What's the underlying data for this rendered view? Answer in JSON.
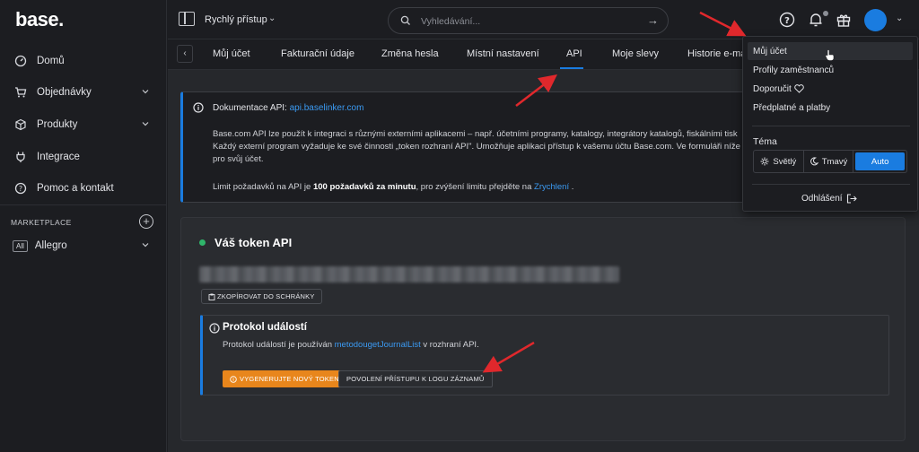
{
  "logo": "base.",
  "sidebar": {
    "items": [
      {
        "label": "Domů",
        "icon": "dashboard-icon"
      },
      {
        "label": "Objednávky",
        "icon": "cart-icon"
      },
      {
        "label": "Produkty",
        "icon": "box-icon"
      },
      {
        "label": "Integrace",
        "icon": "plug-icon"
      },
      {
        "label": "Pomoc a kontakt",
        "icon": "help-icon"
      }
    ],
    "marketplace_heading": "MARKETPLACE",
    "marketplace_tag": "All",
    "marketplace_item": "Allegro"
  },
  "topbar": {
    "quick_access": "Rychlý přístup",
    "search_placeholder": "Vyhledávání..."
  },
  "tabs": [
    "Můj účet",
    "Fakturační údaje",
    "Změna hesla",
    "Místní nastavení",
    "API",
    "Moje slevy",
    "Historie e-ma"
  ],
  "api_info": {
    "doc_label": "Dokumentace API:",
    "doc_link": "api.baselinker.com",
    "desc_line1": "Base.com API lze použít k integraci s různými externími aplikacemi – např. účetními programy, katalogy, integrátory katalogů, fiskálními tisk",
    "desc_line2": "Každý externí program vyžaduje ke své činnosti „token rozhraní API\". Umožňuje aplikaci přístup k vašemu účtu Base.com. Ve formuláři níže",
    "desc_line3": "pro svůj účet.",
    "limit_prefix": "Limit požadavků na API je",
    "limit_value": "100 požadavků za minutu",
    "limit_mid": ", pro zvýšení limitu přejděte na",
    "limit_link": "Zrychlení",
    "limit_suffix": "."
  },
  "token": {
    "title": "Váš token API",
    "copy_button": "ZKOPÍROVAT DO SCHRÁNKY"
  },
  "events": {
    "title": "Protokol událostí",
    "desc_prefix": "Protokol událostí je používán",
    "desc_link": "metodougetJournalList",
    "desc_suffix": "v rozhraní API.",
    "generate_button": "VYGENERUJTE NOVÝ TOKEN",
    "log_button": "POVOLENÍ PŘÍSTUPU K LOGU ZÁZNAMŮ"
  },
  "dropdown": {
    "items": [
      "Můj účet",
      "Profily zaměstnanců",
      "Doporučit",
      "Předplatné a platby"
    ],
    "theme_label": "Téma",
    "theme_options": [
      "Světlý",
      "Tmavý",
      "Auto"
    ],
    "theme_selected": "Auto",
    "logout": "Odhlášení"
  },
  "colors": {
    "accent": "#1a7ce0",
    "link": "#3b9af2",
    "orange": "#e8861c",
    "status_green": "#2fb56a",
    "annotation_red": "#e0282c"
  }
}
